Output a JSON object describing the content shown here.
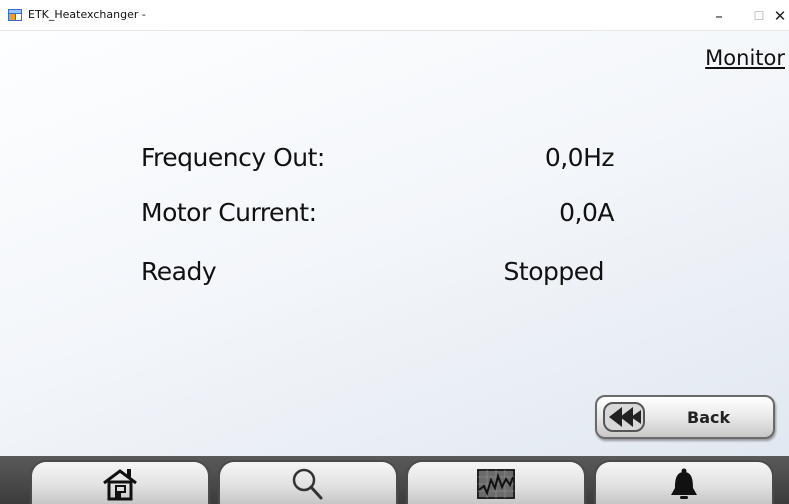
{
  "window": {
    "title": "ETK_Heatexchanger -",
    "minimize_glyph": "–",
    "maximize_glyph": "☐",
    "close_glyph": "✕"
  },
  "header": {
    "monitor_label": "Monitor"
  },
  "readings": [
    {
      "label": "Frequency Out:",
      "value": "0,0Hz"
    },
    {
      "label": "Motor Current:",
      "value": "0,0A"
    },
    {
      "label": "Ready",
      "value": "Stopped"
    }
  ],
  "back_button": {
    "label": "Back",
    "icon": "double-chevron-left-icon"
  },
  "nav": {
    "items": [
      {
        "icon": "home-icon"
      },
      {
        "icon": "search-icon"
      },
      {
        "icon": "trend-chart-icon"
      },
      {
        "icon": "bell-icon"
      }
    ]
  },
  "colors": {
    "text": "#111111",
    "navbar": "#4a4a4a",
    "bell": "#111111"
  }
}
